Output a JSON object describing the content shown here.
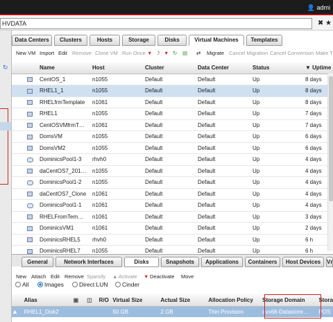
{
  "header": {
    "user": "admi",
    "search_value": "HVDATA"
  },
  "nav_tabs": [
    "Data Centers",
    "Clusters",
    "Hosts",
    "Storage",
    "Disks",
    "Virtual Machines",
    "Templates"
  ],
  "toolbar": {
    "new_vm": "New VM",
    "import": "Import",
    "edit": "Edit",
    "remove": "Remove",
    "clone_vm": "Clone VM",
    "run_once": "Run Once",
    "migrate": "Migrate",
    "cancel_migration": "Cancel Migration",
    "cancel_conversion": "Cancel Conversion",
    "make_template": "Make T"
  },
  "vm_table": {
    "columns": [
      "Name",
      "Host",
      "Cluster",
      "Data Center",
      "Status",
      "Uptime"
    ],
    "rows": [
      {
        "name": "CentOS_1",
        "host": "n1055",
        "cluster": "Default",
        "dc": "Default",
        "status": "Up",
        "uptime": "8 days",
        "pool": false,
        "selected": false
      },
      {
        "name": "RHEL1_1",
        "host": "n1055",
        "cluster": "Default",
        "dc": "Default",
        "status": "Up",
        "uptime": "8 days",
        "pool": false,
        "selected": true
      },
      {
        "name": "RHELfrmTemplate",
        "host": "n1061",
        "cluster": "Default",
        "dc": "Default",
        "status": "Up",
        "uptime": "8 days",
        "pool": false,
        "selected": false
      },
      {
        "name": "RHEL1",
        "host": "n1055",
        "cluster": "Default",
        "dc": "Default",
        "status": "Up",
        "uptime": "7 days",
        "pool": false,
        "selected": false
      },
      {
        "name": "CentOSVMfrmT…",
        "host": "n1061",
        "cluster": "Default",
        "dc": "Default",
        "status": "Up",
        "uptime": "7 days",
        "pool": false,
        "selected": false
      },
      {
        "name": "DomsVM",
        "host": "n1055",
        "cluster": "Default",
        "dc": "Default",
        "status": "Up",
        "uptime": "6 days",
        "pool": false,
        "selected": false
      },
      {
        "name": "DomsVM2",
        "host": "n1055",
        "cluster": "Default",
        "dc": "Default",
        "status": "Up",
        "uptime": "6 days",
        "pool": false,
        "selected": false
      },
      {
        "name": "DominicsPool1-3",
        "host": "rhvh0",
        "cluster": "Default",
        "dc": "Default",
        "status": "Up",
        "uptime": "4 days",
        "pool": true,
        "selected": false
      },
      {
        "name": "daCentOS7_201…",
        "host": "n1055",
        "cluster": "Default",
        "dc": "Default",
        "status": "Up",
        "uptime": "4 days",
        "pool": false,
        "selected": false
      },
      {
        "name": "DominicsPool1-2",
        "host": "n1055",
        "cluster": "Default",
        "dc": "Default",
        "status": "Up",
        "uptime": "4 days",
        "pool": true,
        "selected": false
      },
      {
        "name": "daCentOS7_Clone",
        "host": "n1061",
        "cluster": "Default",
        "dc": "Default",
        "status": "Up",
        "uptime": "4 days",
        "pool": false,
        "selected": false
      },
      {
        "name": "DominicsPool1-1",
        "host": "n1061",
        "cluster": "Default",
        "dc": "Default",
        "status": "Up",
        "uptime": "4 days",
        "pool": true,
        "selected": false
      },
      {
        "name": "RHELFromTem…",
        "host": "n1061",
        "cluster": "Default",
        "dc": "Default",
        "status": "Up",
        "uptime": "3 days",
        "pool": false,
        "selected": false
      },
      {
        "name": "DominicsVM1",
        "host": "n1061",
        "cluster": "Default",
        "dc": "Default",
        "status": "Up",
        "uptime": "2 days",
        "pool": false,
        "selected": false
      },
      {
        "name": "DominicsRHEL5",
        "host": "rhvh0",
        "cluster": "Default",
        "dc": "Default",
        "status": "Up",
        "uptime": "6 h",
        "pool": false,
        "selected": false
      },
      {
        "name": "DominicsRHEL7",
        "host": "n1055",
        "cluster": "Default",
        "dc": "Default",
        "status": "Up",
        "uptime": "6 h",
        "pool": false,
        "selected": false
      }
    ]
  },
  "sub_tabs": [
    "General",
    "Network Interfaces",
    "Disks",
    "Snapshots",
    "Applications",
    "Containers",
    "Host Devices",
    "Vm Devi"
  ],
  "disk_toolbar": {
    "new": "New",
    "attach": "Attach",
    "edit": "Edit",
    "remove": "Remove",
    "sparsify": "Sparsify",
    "activate": "Activate",
    "deactivate": "Deactivate",
    "move": "Move"
  },
  "disk_filter": {
    "all": "All",
    "images": "Images",
    "direct_lun": "Direct LUN",
    "cinder": "Cinder"
  },
  "disk_table": {
    "columns": [
      "Alias",
      "R/O",
      "Virtual Size",
      "Actual Size",
      "Allocation Policy",
      "Storage Domain",
      "Stora"
    ],
    "row": {
      "alias": "RHEL1_Disk2",
      "virtual_size": "50 GB",
      "actual_size": "2 GB",
      "policy": "Thin Provision",
      "domain": "dvx68-Datastore…",
      "storage_type": "POS"
    }
  }
}
